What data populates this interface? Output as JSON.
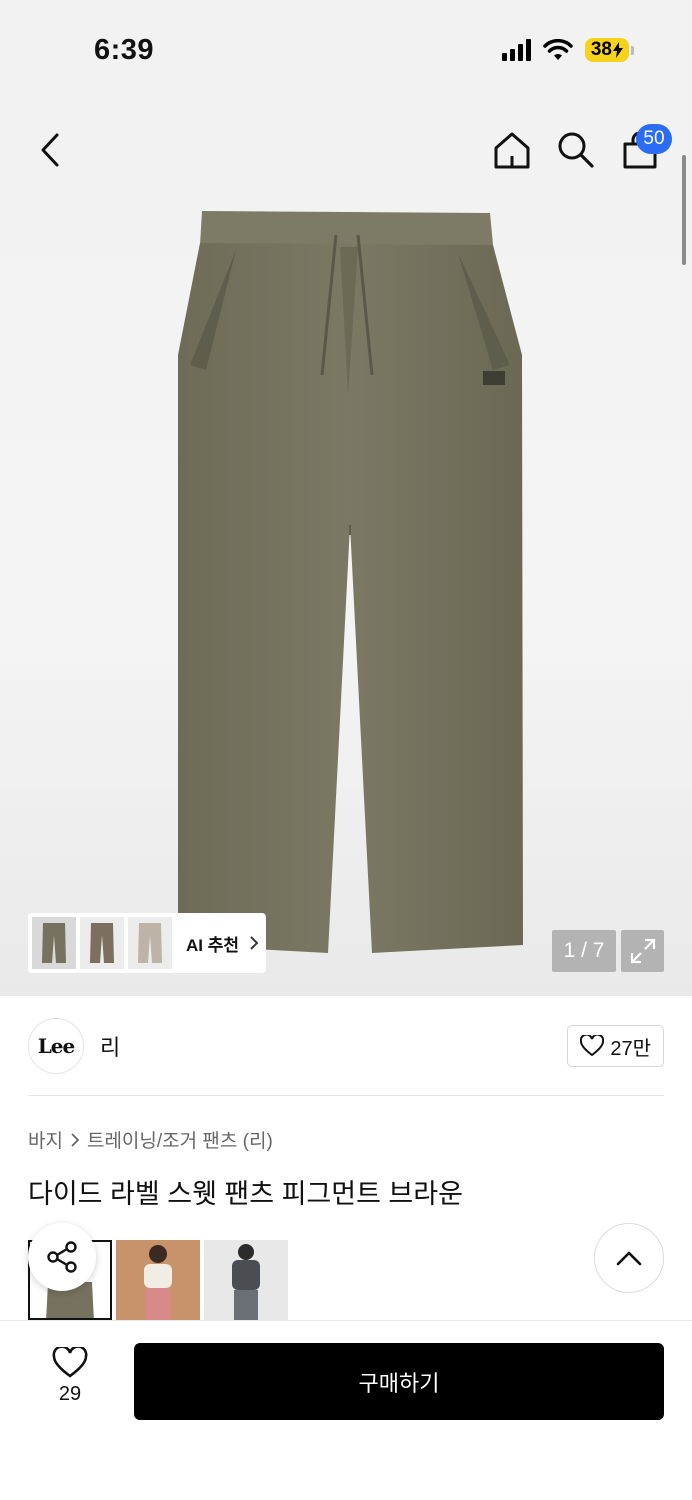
{
  "status_bar": {
    "time": "6:39",
    "battery": "38"
  },
  "header": {
    "cart_count": "50"
  },
  "gallery": {
    "counter": "1 / 7",
    "ai_recommend_label": "AI 추천"
  },
  "brand": {
    "logo_text": "Lee",
    "name": "리",
    "likes": "27만"
  },
  "breadcrumb": {
    "category": "바지",
    "subcategory": "트레이닝/조거 팬츠 (리)"
  },
  "product": {
    "title": "다이드 라벨 스웻 팬츠 피그먼트 브라운"
  },
  "bottom_bar": {
    "wish_count": "29",
    "buy_label": "구매하기"
  },
  "colors": {
    "badge": "#2a6df4",
    "battery": "#f7d21a",
    "pants": "#76735f"
  }
}
